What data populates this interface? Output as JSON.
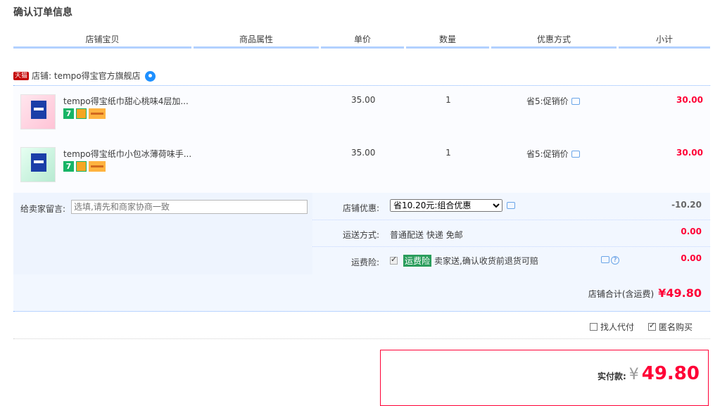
{
  "page_title": "确认订单信息",
  "columns": [
    "店铺宝贝",
    "商品属性",
    "单价",
    "数量",
    "优惠方式",
    "小计"
  ],
  "shop": {
    "badge": "天猫",
    "label": "店铺: tempo得宝官方旗舰店"
  },
  "items": [
    {
      "name": "tempo得宝纸巾甜心桃味4层加...",
      "price": "35.00",
      "qty": "1",
      "promo": "省5:促销价",
      "subtotal": "30.00",
      "badge_seven": "7"
    },
    {
      "name": "tempo得宝纸巾小包冰薄荷味手...",
      "price": "35.00",
      "qty": "1",
      "promo": "省5:促销价",
      "subtotal": "30.00",
      "badge_seven": "7"
    }
  ],
  "message": {
    "label": "给卖家留言:",
    "placeholder": "选填,请先和商家协商一致"
  },
  "discount": {
    "label": "店铺优惠:",
    "selected": "省10.20元:组合优惠",
    "amount": "-10.20"
  },
  "shipping": {
    "label": "运送方式:",
    "value": "普通配送 快递 免邮",
    "amount": "0.00"
  },
  "insurance": {
    "label": "运费险:",
    "tag": "运费险",
    "text": "卖家送,确认收货前退货可赔",
    "amount": "0.00"
  },
  "shop_total": {
    "label": "店铺合计(含运费)",
    "value": "¥49.80"
  },
  "options": {
    "proxy_pay": "找人代付",
    "anonymous": "匿名购买"
  },
  "pay": {
    "label": "实付款:",
    "currency": "¥",
    "value": "49.80"
  },
  "colors": {
    "accent_red": "#ff0036",
    "line_blue": "#b2d1ff",
    "bg_blue": "#f2f7ff"
  }
}
